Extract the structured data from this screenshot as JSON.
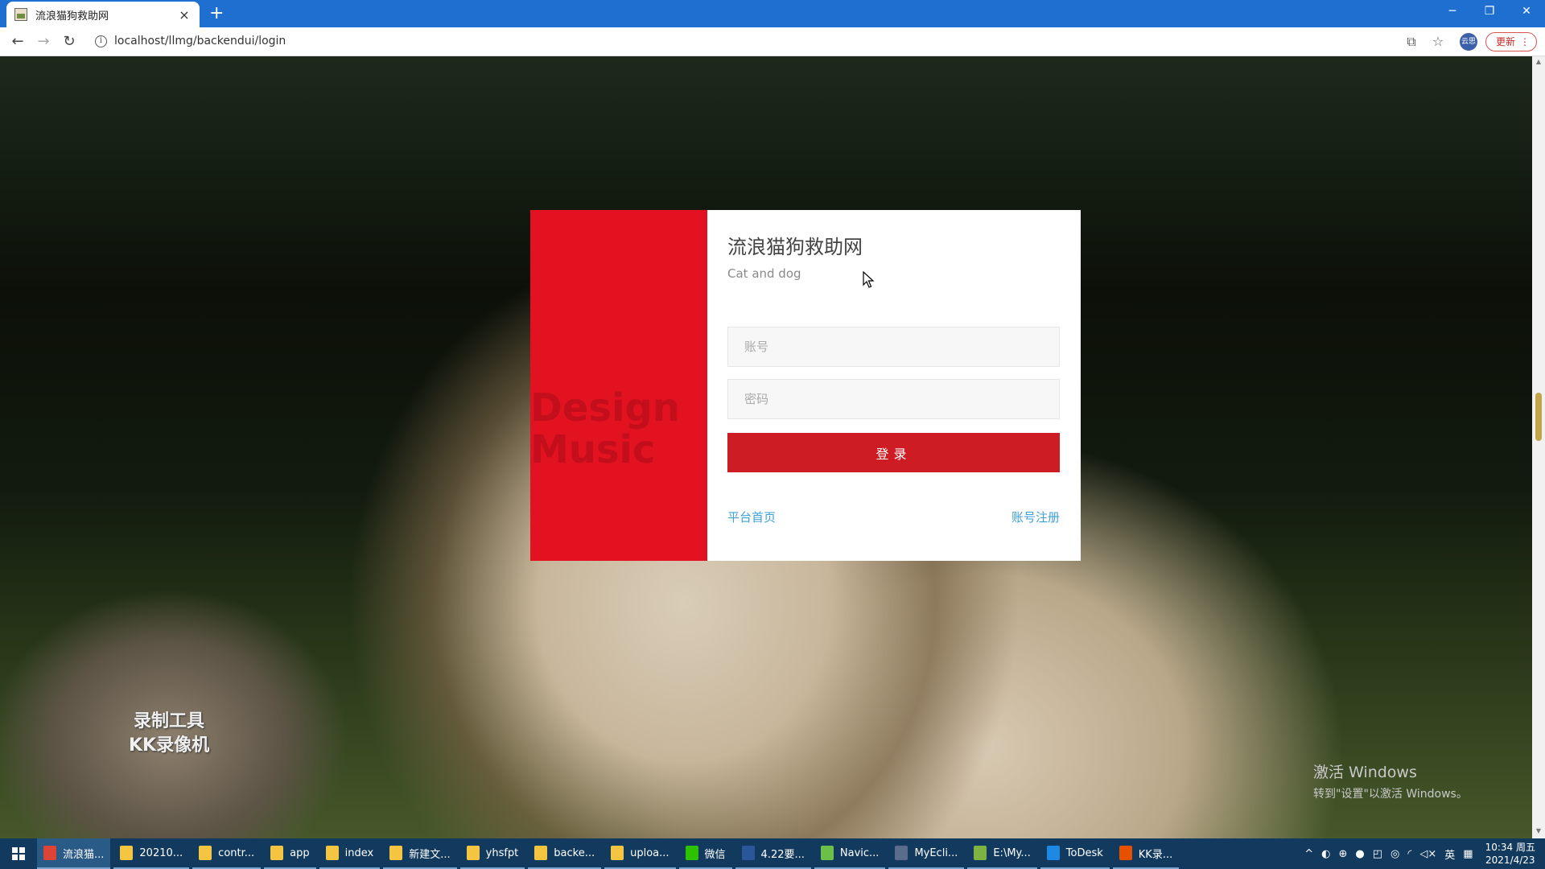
{
  "browser": {
    "tab_title": "流浪猫狗救助网",
    "tab_close": "×",
    "new_tab": "+",
    "url": "localhost/llmg/backendui/login",
    "update_label": "更新",
    "profile_label": "云思"
  },
  "login": {
    "title": "流浪猫狗救助网",
    "subtitle": "Cat and dog",
    "username_placeholder": "账号",
    "password_placeholder": "密码",
    "submit_label": "登录",
    "home_link": "平台首页",
    "register_link": "账号注册",
    "panel_ghost_text": [
      "Design",
      "Music"
    ],
    "accent_color": "#e31221",
    "button_color": "#cd1c23",
    "link_color": "#3fa0d6"
  },
  "overlay": {
    "recorder_line1": "录制工具",
    "recorder_line2": "KK录像机",
    "activate_title": "激活 Windows",
    "activate_sub": "转到\"设置\"以激活 Windows。"
  },
  "taskbar": {
    "items": [
      {
        "label": "流浪猫...",
        "icon": "chrome-icon",
        "color": "#db4437"
      },
      {
        "label": "20210...",
        "icon": "folder-icon",
        "color": "#f5c542"
      },
      {
        "label": "contr...",
        "icon": "folder-icon",
        "color": "#f5c542"
      },
      {
        "label": "app",
        "icon": "folder-icon",
        "color": "#f5c542"
      },
      {
        "label": "index",
        "icon": "folder-icon",
        "color": "#f5c542"
      },
      {
        "label": "新建文...",
        "icon": "folder-icon",
        "color": "#f5c542"
      },
      {
        "label": "yhsfpt",
        "icon": "folder-icon",
        "color": "#f5c542"
      },
      {
        "label": "backe...",
        "icon": "folder-icon",
        "color": "#f5c542"
      },
      {
        "label": "uploa...",
        "icon": "folder-icon",
        "color": "#f5c542"
      },
      {
        "label": "微信",
        "icon": "wechat-icon",
        "color": "#2dc100"
      },
      {
        "label": "4.22要...",
        "icon": "word-icon",
        "color": "#2b579a"
      },
      {
        "label": "Navic...",
        "icon": "navicat-icon",
        "color": "#6cc04a"
      },
      {
        "label": "MyEcli...",
        "icon": "myeclipse-icon",
        "color": "#5a6b8c"
      },
      {
        "label": "E:\\My...",
        "icon": "notepad-icon",
        "color": "#7cb342"
      },
      {
        "label": "ToDesk",
        "icon": "todesk-icon",
        "color": "#1e88e5"
      },
      {
        "label": "KK录...",
        "icon": "kk-recorder-icon",
        "color": "#e65100"
      }
    ],
    "ime": "英",
    "time": "10:34 周五",
    "date": "2021/4/23"
  }
}
